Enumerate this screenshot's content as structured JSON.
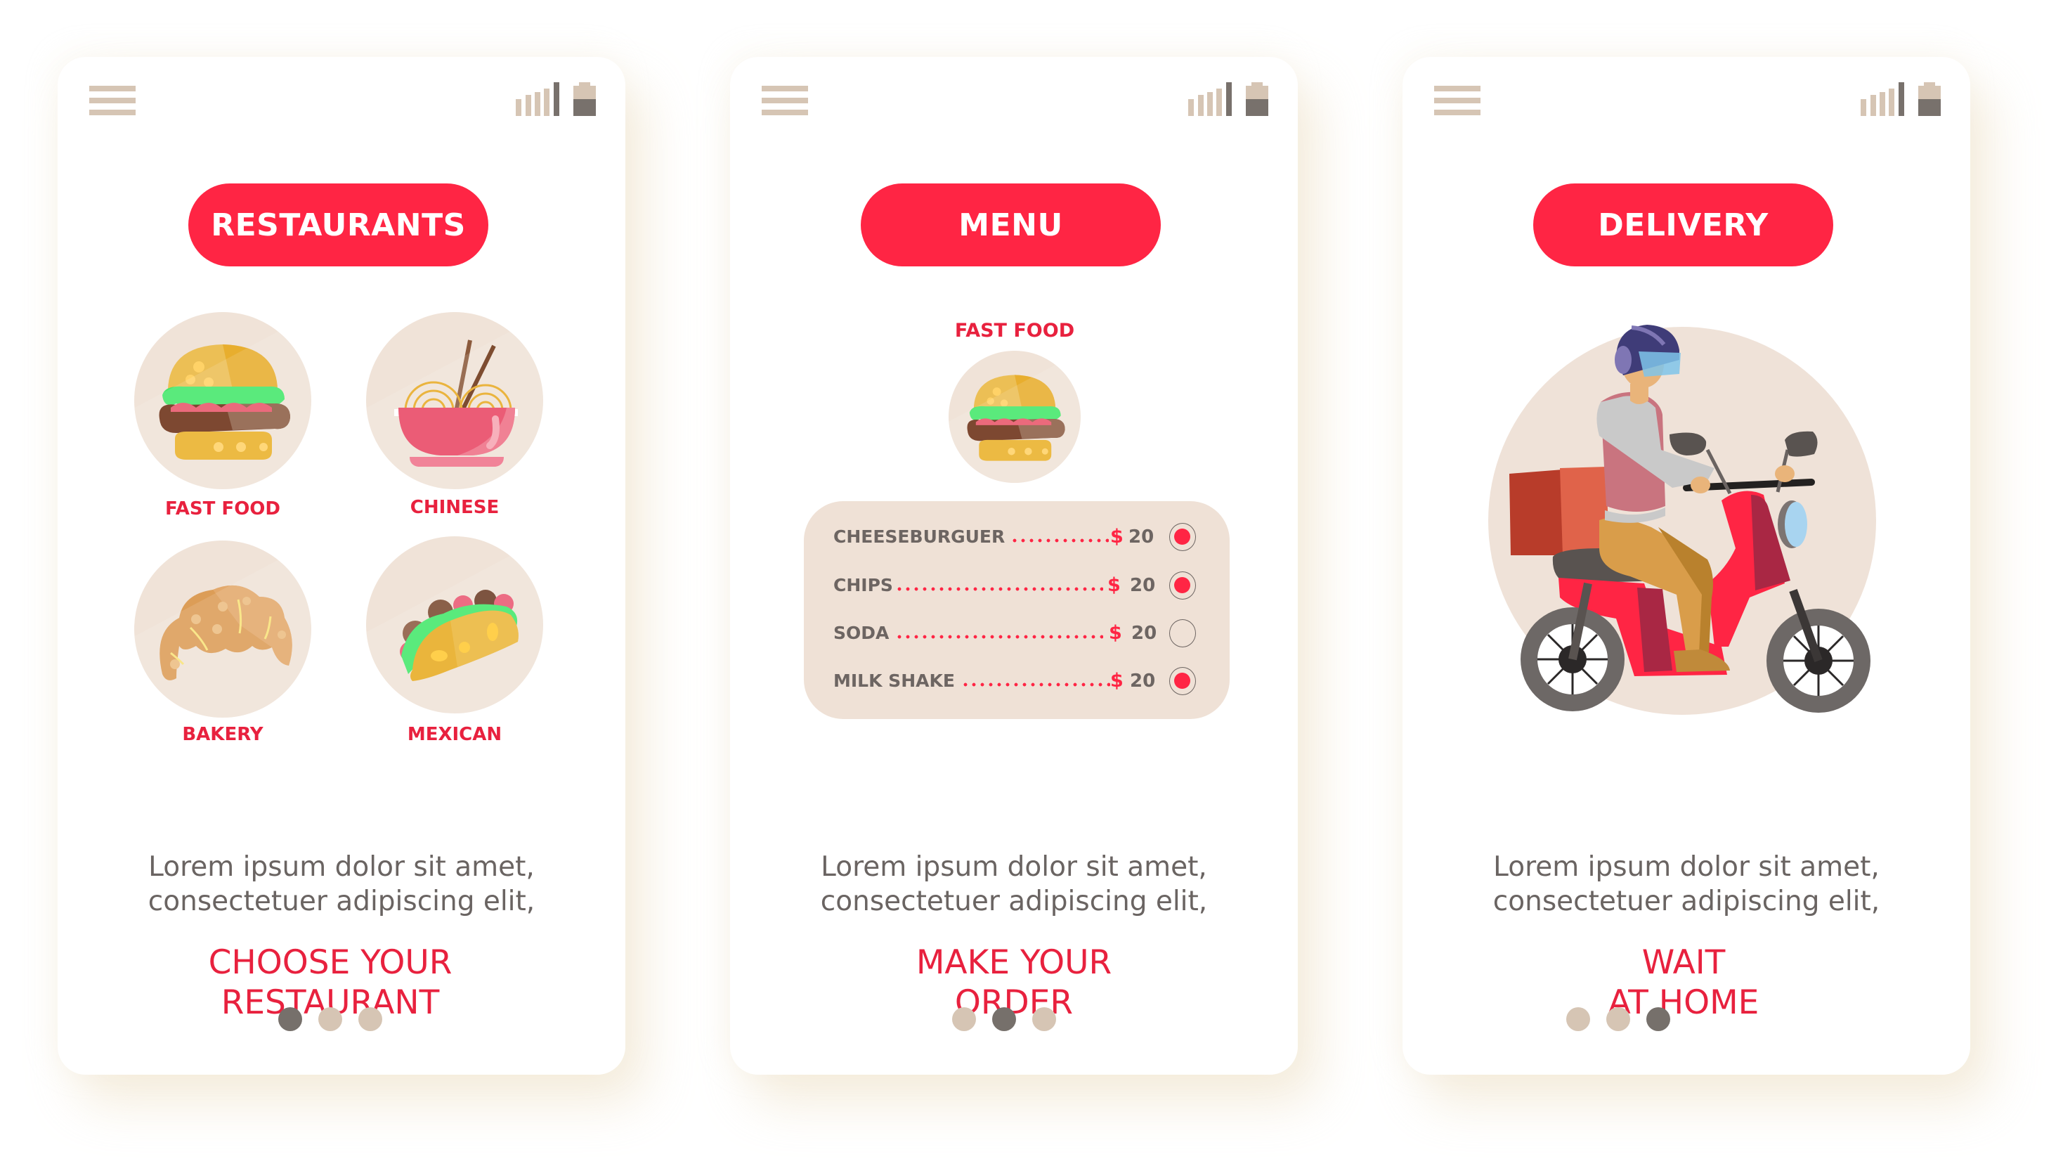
{
  "status_bar": {
    "menu_icon": "hamburger-menu-icon",
    "signal_icon": "signal-strength-icon",
    "signal_bars_filled": 5,
    "battery_icon": "battery-icon",
    "battery_level": 0.55
  },
  "colors": {
    "accent": "#ff2544",
    "accent_text": "#e8213e",
    "body_text": "#6a6462",
    "circle_bg": "#f0e3d8",
    "dot_inactive": "#d6c5b4",
    "dot_active": "#76706b"
  },
  "screens": [
    {
      "id": "restaurants",
      "header_button": "RESTAURANTS",
      "categories": [
        {
          "label": "FAST FOOD",
          "icon": "burger-icon"
        },
        {
          "label": "CHINESE",
          "icon": "noodle-bowl-icon"
        },
        {
          "label": "BAKERY",
          "icon": "croissant-icon"
        },
        {
          "label": "MEXICAN",
          "icon": "taco-icon"
        }
      ],
      "description_line1": "Lorem ipsum dolor sit amet,",
      "description_line2": "consectetuer adipiscing elit,",
      "headline_line1": "CHOOSE YOUR",
      "headline_line2": "RESTAURANT",
      "pagination": {
        "total": 3,
        "active": 1
      }
    },
    {
      "id": "menu",
      "header_button": "MENU",
      "selected_category": {
        "label": "FAST FOOD",
        "icon": "burger-icon"
      },
      "menu_items": [
        {
          "name": "CHEESEBURGUER",
          "currency": "$",
          "price": "20",
          "selected": true
        },
        {
          "name": "CHIPS",
          "currency": "$",
          "price": "20",
          "selected": true
        },
        {
          "name": "SODA",
          "currency": "$",
          "price": "20",
          "selected": false
        },
        {
          "name": "MILK SHAKE",
          "currency": "$",
          "price": "20",
          "selected": true
        }
      ],
      "description_line1": "Lorem ipsum dolor sit amet,",
      "description_line2": "consectetuer adipiscing elit,",
      "headline_line1": "MAKE YOUR",
      "headline_line2": "ORDER",
      "pagination": {
        "total": 3,
        "active": 2
      }
    },
    {
      "id": "delivery",
      "header_button": "DELIVERY",
      "illustration": "delivery-scooter-rider-illustration",
      "description_line1": "Lorem ipsum dolor sit amet,",
      "description_line2": "consectetuer adipiscing elit,",
      "headline_line1": "WAIT",
      "headline_line2": "AT HOME",
      "pagination": {
        "total": 3,
        "active": 3
      }
    }
  ]
}
